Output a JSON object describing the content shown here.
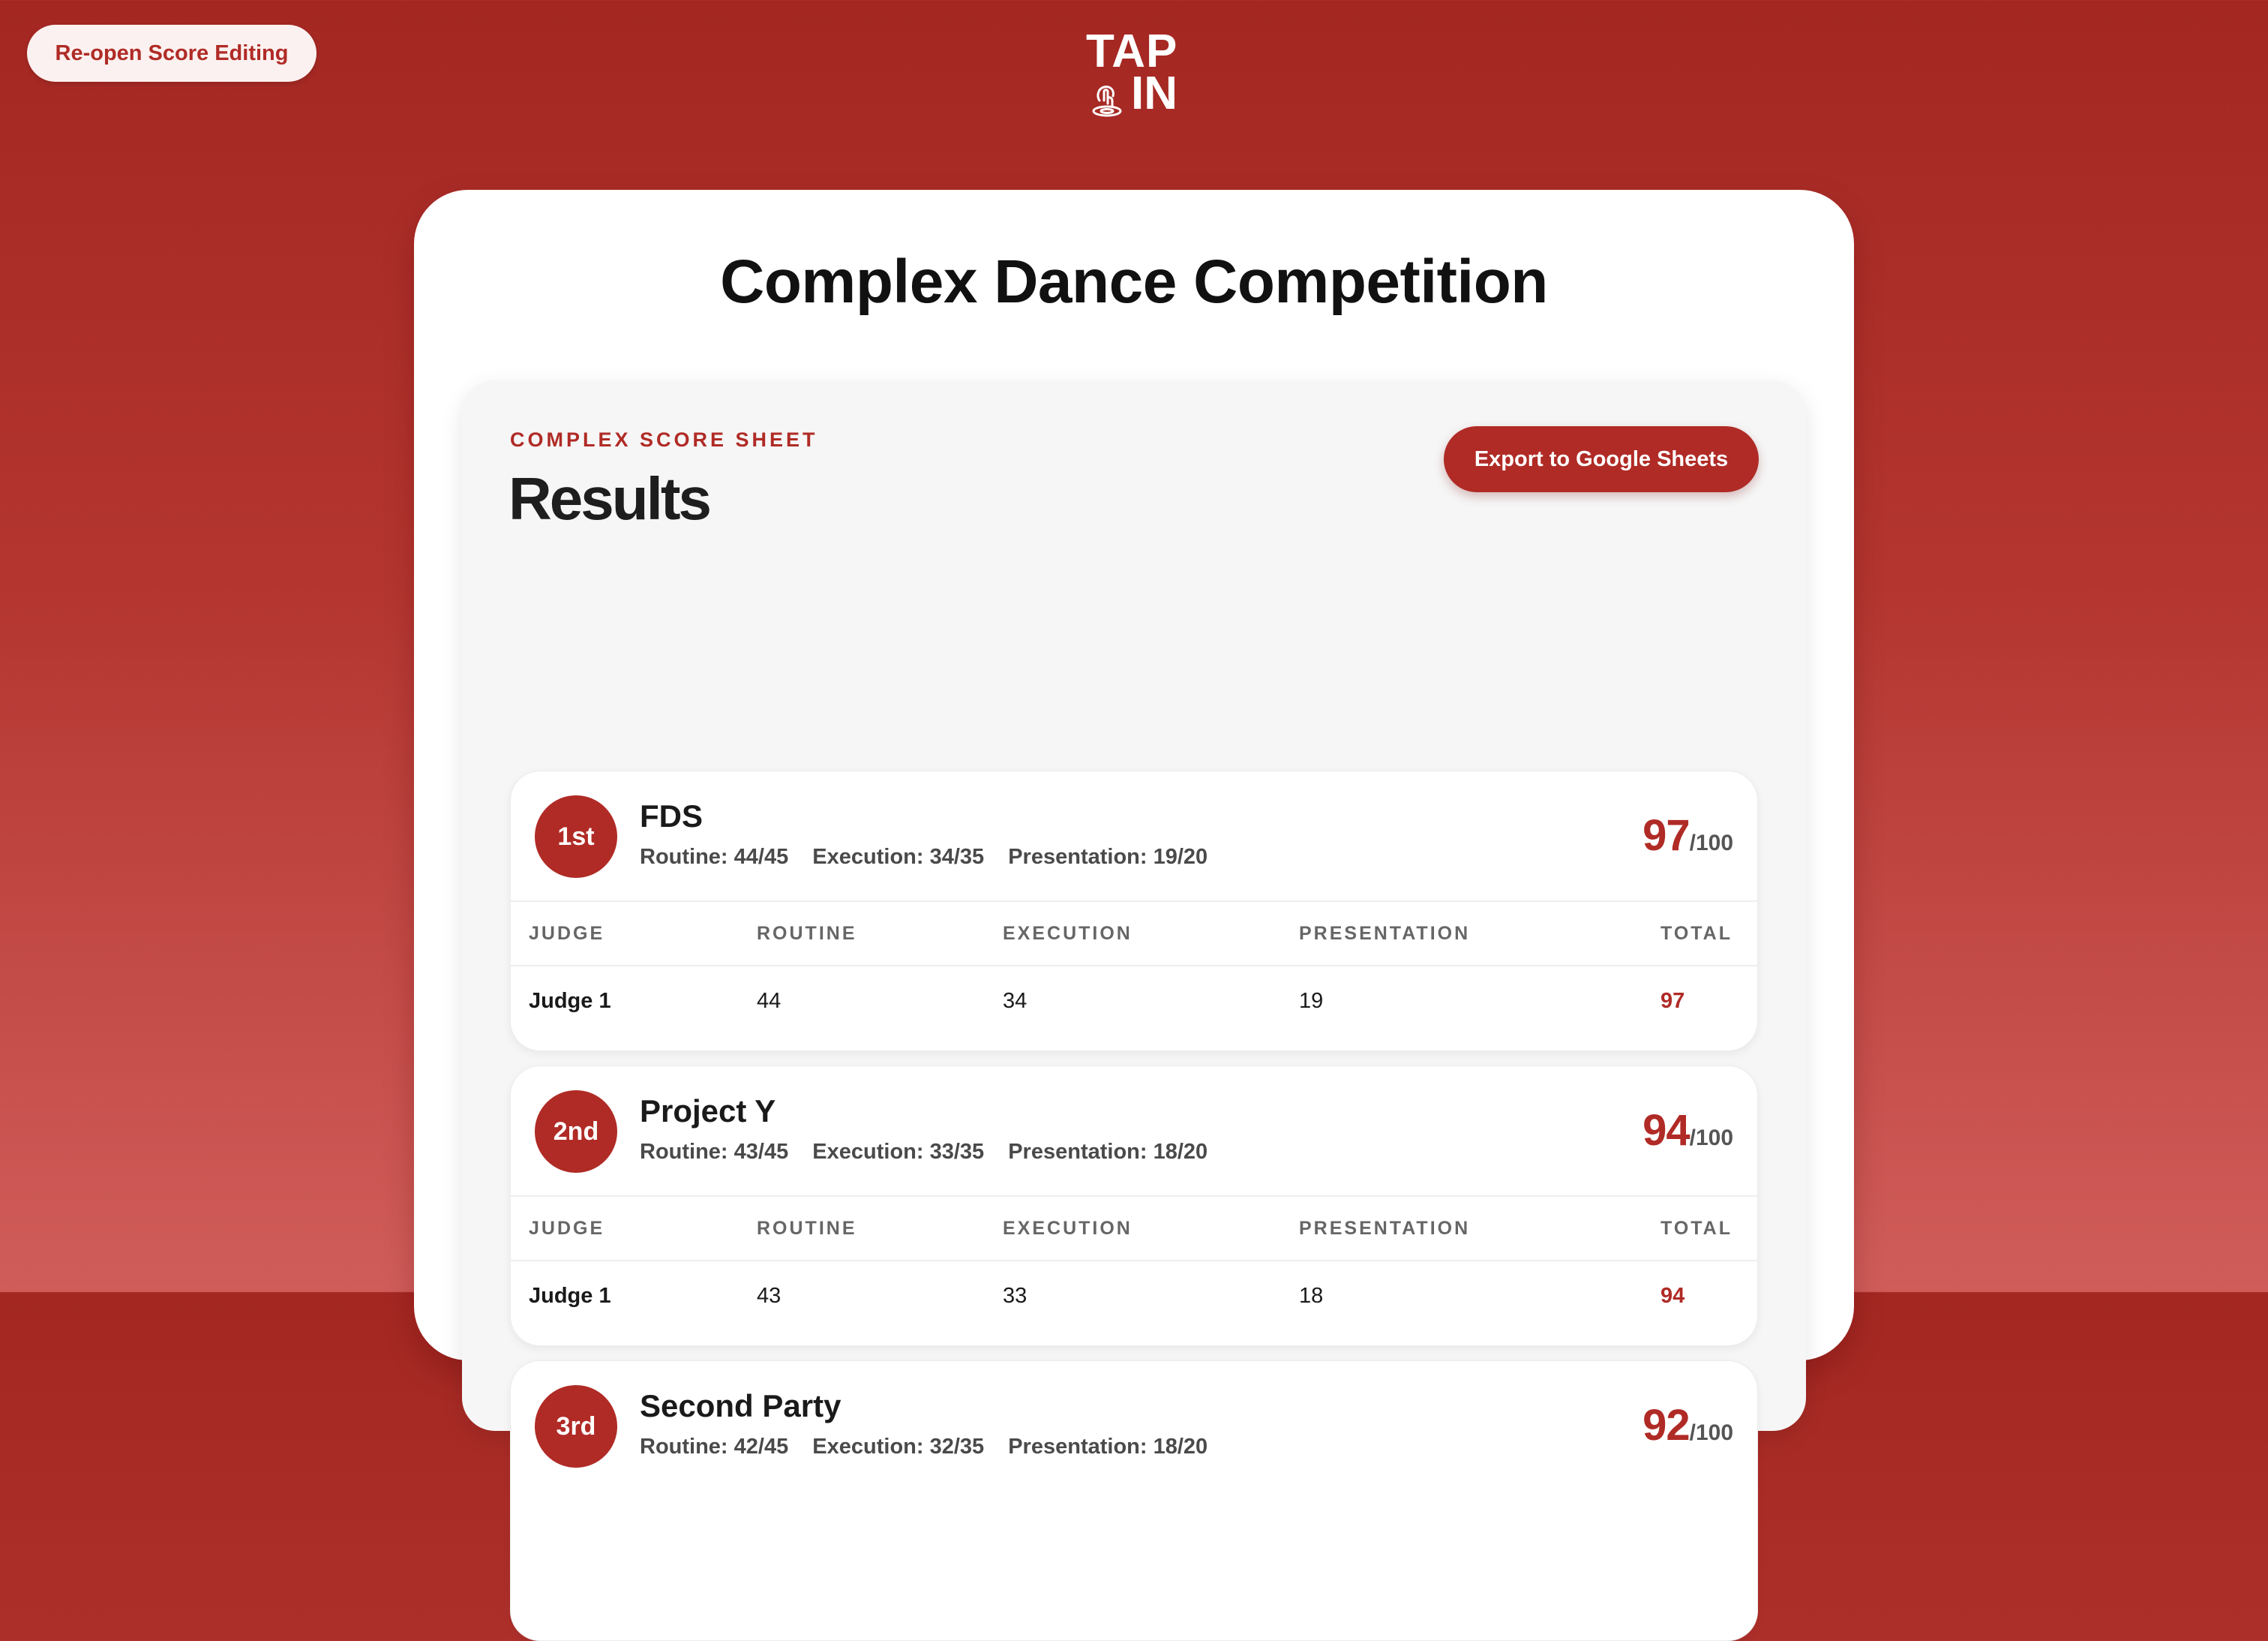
{
  "header": {
    "reopen_label": "Re-open Score Editing",
    "logo_line1": "TAP",
    "logo_line2": "IN",
    "logo_icon": "tap-finger-icon"
  },
  "competition": {
    "title": "Complex Dance Competition"
  },
  "sheet": {
    "kicker": "COMPLEX SCORE SHEET",
    "title": "Results",
    "export_label": "Export to Google Sheets"
  },
  "columns": [
    "JUDGE",
    "ROUTINE",
    "EXECUTION",
    "PRESENTATION",
    "TOTAL"
  ],
  "colors": {
    "accent": "#b02b26",
    "background_top": "#a42722",
    "background_bottom": "#d05d5a"
  },
  "teams": [
    {
      "rank": "1st",
      "name": "FDS",
      "routine": "Routine: 44/45",
      "execution": "Execution: 34/35",
      "presentation": "Presentation: 19/20",
      "score": "97",
      "max": "/100",
      "judges": [
        {
          "judge": "Judge 1",
          "routine": "44",
          "execution": "34",
          "presentation": "19",
          "total": "97"
        }
      ]
    },
    {
      "rank": "2nd",
      "name": "Project Y",
      "routine": "Routine: 43/45",
      "execution": "Execution: 33/35",
      "presentation": "Presentation: 18/20",
      "score": "94",
      "max": "/100",
      "judges": [
        {
          "judge": "Judge 1",
          "routine": "43",
          "execution": "33",
          "presentation": "18",
          "total": "94"
        }
      ]
    },
    {
      "rank": "3rd",
      "name": "Second Party",
      "routine": "Routine: 42/45",
      "execution": "Execution: 32/35",
      "presentation": "Presentation: 18/20",
      "score": "92",
      "max": "/100",
      "judges": []
    }
  ]
}
